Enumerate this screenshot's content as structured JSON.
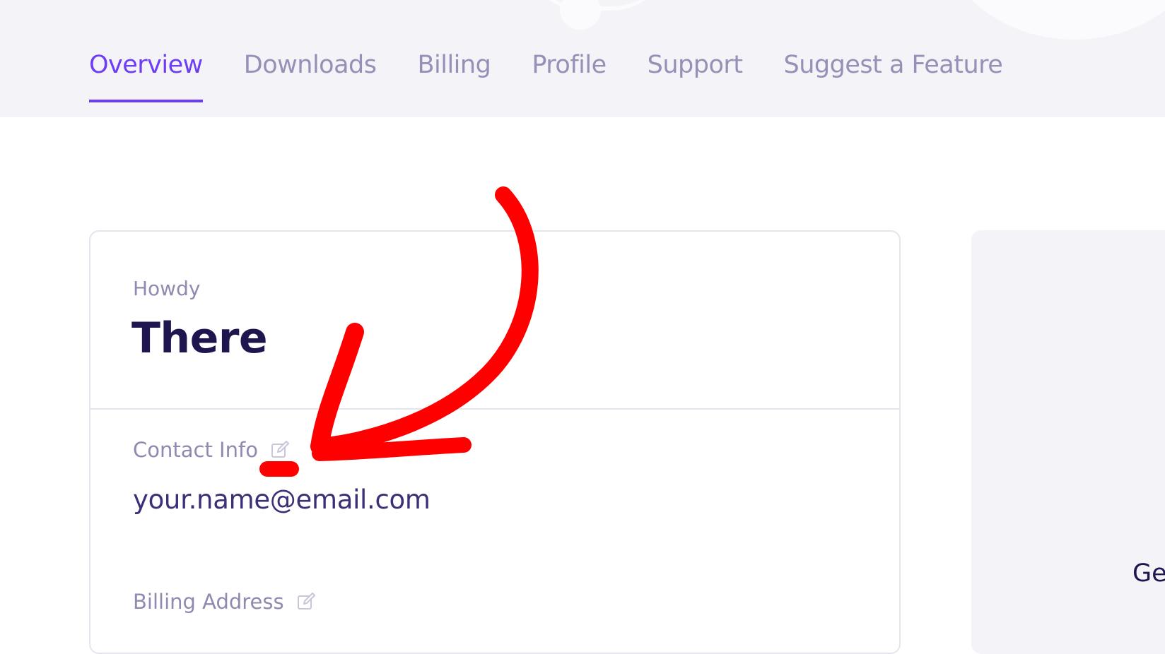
{
  "nav": {
    "tabs": [
      {
        "label": "Overview",
        "active": true
      },
      {
        "label": "Downloads",
        "active": false
      },
      {
        "label": "Billing",
        "active": false
      },
      {
        "label": "Profile",
        "active": false
      },
      {
        "label": "Support",
        "active": false
      },
      {
        "label": "Suggest a Feature",
        "active": false
      }
    ]
  },
  "card": {
    "greeting_label": "Howdy",
    "greeting_name": "There",
    "contact": {
      "label": "Contact Info",
      "email": "your.name@email.com",
      "edit_icon": "edit-icon"
    },
    "billing": {
      "label": "Billing Address",
      "edit_icon": "edit-icon"
    }
  },
  "side_panel": {
    "text": "Ge"
  },
  "colors": {
    "accent": "#6d3cf5",
    "tab_inactive": "#9590b6",
    "heading": "#1f1650",
    "annotation": "#ff0000"
  }
}
